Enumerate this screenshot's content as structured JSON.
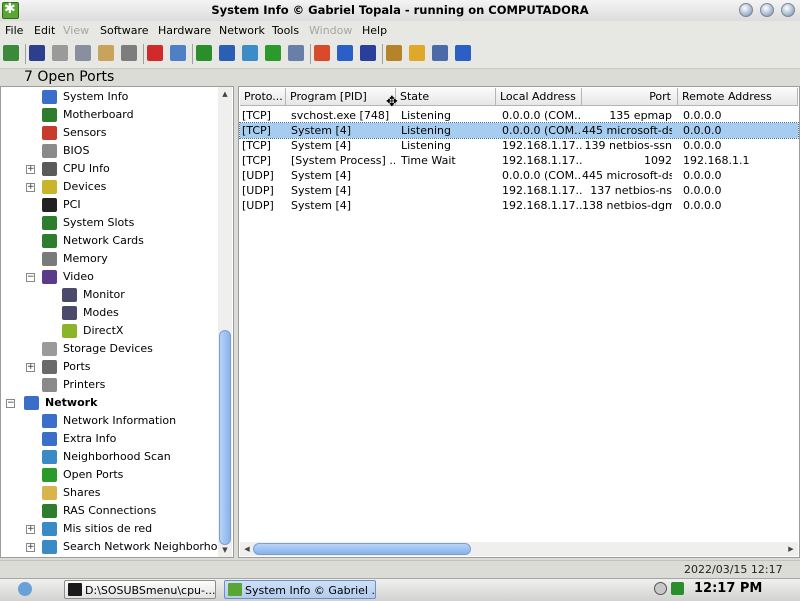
{
  "window": {
    "title": "System Info  © Gabriel Topala - running on COMPUTADORA"
  },
  "menu": [
    {
      "label": "File",
      "enabled": true
    },
    {
      "label": "Edit",
      "enabled": true
    },
    {
      "label": "View",
      "enabled": false
    },
    {
      "label": "Software",
      "enabled": true
    },
    {
      "label": "Hardware",
      "enabled": true
    },
    {
      "label": "Network",
      "enabled": true
    },
    {
      "label": "Tools",
      "enabled": true
    },
    {
      "label": "Window",
      "enabled": false
    },
    {
      "label": "Help",
      "enabled": true
    }
  ],
  "toolbar_icons": [
    {
      "name": "exit-icon",
      "color": "#3a8a3a"
    },
    {
      "name": "save-icon",
      "color": "#2b3f8c"
    },
    {
      "name": "cut-icon",
      "color": "#9a9a9a"
    },
    {
      "name": "copy-icon",
      "color": "#8a8fa0"
    },
    {
      "name": "paste-icon",
      "color": "#c9a35a"
    },
    {
      "name": "print-icon",
      "color": "#7d7d7d"
    },
    {
      "name": "stop-icon",
      "color": "#d12a2a"
    },
    {
      "name": "message-icon",
      "color": "#4f7fc4"
    },
    {
      "name": "color-icon",
      "color": "#2a8f2a"
    },
    {
      "name": "chart-icon",
      "color": "#2a5fb5"
    },
    {
      "name": "globe-icon",
      "color": "#3c8cc8"
    },
    {
      "name": "transfer-icon",
      "color": "#2a9a2a"
    },
    {
      "name": "report-icon",
      "color": "#6a7fa8"
    },
    {
      "name": "power-icon",
      "color": "#d84a2a"
    },
    {
      "name": "refresh-icon",
      "color": "#2a5fc8"
    },
    {
      "name": "shield-icon",
      "color": "#2a3f9a"
    },
    {
      "name": "gallery-icon",
      "color": "#b5832a"
    },
    {
      "name": "weather-icon",
      "color": "#e0a82a"
    },
    {
      "name": "options-icon",
      "color": "#4a6aa8"
    },
    {
      "name": "help-icon",
      "color": "#2a5fc8"
    }
  ],
  "section_title": "7 Open Ports",
  "tree": [
    {
      "label": "System Info",
      "indent": 1,
      "icon": "info-icon",
      "color": "#3a6ec8",
      "expander": ""
    },
    {
      "label": "Motherboard",
      "indent": 1,
      "icon": "motherboard-icon",
      "color": "#2e7d2e",
      "expander": ""
    },
    {
      "label": "Sensors",
      "indent": 1,
      "icon": "thermometer-icon",
      "color": "#c83a2a",
      "expander": ""
    },
    {
      "label": "BIOS",
      "indent": 1,
      "icon": "chip-icon",
      "color": "#8a8a8a",
      "expander": ""
    },
    {
      "label": "CPU Info",
      "indent": 1,
      "icon": "cpu-icon",
      "color": "#5a5a5a",
      "expander": "+"
    },
    {
      "label": "Devices",
      "indent": 1,
      "icon": "devices-icon",
      "color": "#c8b52a",
      "expander": "+"
    },
    {
      "label": "PCI",
      "indent": 1,
      "icon": "pci-icon",
      "color": "#222222",
      "expander": ""
    },
    {
      "label": "System Slots",
      "indent": 1,
      "icon": "slots-icon",
      "color": "#2e7d2e",
      "expander": ""
    },
    {
      "label": "Network Cards",
      "indent": 1,
      "icon": "network-card-icon",
      "color": "#2e7d2e",
      "expander": ""
    },
    {
      "label": "Memory",
      "indent": 1,
      "icon": "memory-icon",
      "color": "#7a7a7a",
      "expander": ""
    },
    {
      "label": "Video",
      "indent": 1,
      "icon": "video-icon",
      "color": "#5a3a8a",
      "expander": "−"
    },
    {
      "label": "Monitor",
      "indent": 2,
      "icon": "monitor-icon",
      "color": "#4a4a6a",
      "expander": ""
    },
    {
      "label": "Modes",
      "indent": 2,
      "icon": "modes-icon",
      "color": "#4a4a6a",
      "expander": ""
    },
    {
      "label": "DirectX",
      "indent": 2,
      "icon": "directx-icon",
      "color": "#8ab52a",
      "expander": ""
    },
    {
      "label": "Storage Devices",
      "indent": 1,
      "icon": "storage-icon",
      "color": "#9a9a9a",
      "expander": ""
    },
    {
      "label": "Ports",
      "indent": 1,
      "icon": "ports-icon",
      "color": "#6a6a6a",
      "expander": "+"
    },
    {
      "label": "Printers",
      "indent": 1,
      "icon": "printer-icon",
      "color": "#8a8a8a",
      "expander": ""
    },
    {
      "label": "Network",
      "indent": 0,
      "icon": "network-icon",
      "color": "#3a6ec8",
      "expander": "−",
      "bold": true
    },
    {
      "label": "Network Information",
      "indent": 1,
      "icon": "info-icon",
      "color": "#3a6ec8",
      "expander": ""
    },
    {
      "label": "Extra Info",
      "indent": 1,
      "icon": "info-icon",
      "color": "#3a6ec8",
      "expander": ""
    },
    {
      "label": "Neighborhood Scan",
      "indent": 1,
      "icon": "scan-icon",
      "color": "#3a8ac8",
      "expander": ""
    },
    {
      "label": "Open Ports",
      "indent": 1,
      "icon": "transfer-icon",
      "color": "#2a9a2a",
      "expander": ""
    },
    {
      "label": "Shares",
      "indent": 1,
      "icon": "folder-icon",
      "color": "#d8b54a",
      "expander": ""
    },
    {
      "label": "RAS Connections",
      "indent": 1,
      "icon": "ras-icon",
      "color": "#2e7d2e",
      "expander": ""
    },
    {
      "label": "Mis sitios de red",
      "indent": 1,
      "icon": "globe-icon",
      "color": "#3a8ac8",
      "expander": "+"
    },
    {
      "label": "Search Network Neighborhood",
      "indent": 1,
      "icon": "globe-icon",
      "color": "#3a8ac8",
      "expander": "+"
    }
  ],
  "table": {
    "columns": [
      "Proto...",
      "Program [PID]",
      "State",
      "Local Address",
      "Port",
      "Remote Address"
    ],
    "rows": [
      {
        "proto": "[TCP]",
        "program": "svchost.exe [748]",
        "state": "Listening",
        "local": "0.0.0.0 (COM...",
        "port": "135 epmap",
        "remote": "0.0.0.0",
        "selected": false
      },
      {
        "proto": "[TCP]",
        "program": "System [4]",
        "state": "Listening",
        "local": "0.0.0.0 (COM...",
        "port": "445 microsoft-ds",
        "remote": "0.0.0.0",
        "selected": true
      },
      {
        "proto": "[TCP]",
        "program": "System [4]",
        "state": "Listening",
        "local": "192.168.1.17...",
        "port": "139 netbios-ssn",
        "remote": "0.0.0.0",
        "selected": false
      },
      {
        "proto": "[TCP]",
        "program": "[System Process] ...",
        "state": "Time Wait",
        "local": "192.168.1.17...",
        "port": "1092",
        "remote": "192.168.1.1",
        "selected": false
      },
      {
        "proto": "[UDP]",
        "program": "System [4]",
        "state": "",
        "local": "0.0.0.0 (COM...",
        "port": "445 microsoft-ds",
        "remote": "0.0.0.0",
        "selected": false
      },
      {
        "proto": "[UDP]",
        "program": "System [4]",
        "state": "",
        "local": "192.168.1.17...",
        "port": "137 netbios-ns",
        "remote": "0.0.0.0",
        "selected": false
      },
      {
        "proto": "[UDP]",
        "program": "System [4]",
        "state": "",
        "local": "192.168.1.17...",
        "port": "138 netbios-dgm",
        "remote": "0.0.0.0",
        "selected": false
      }
    ]
  },
  "status": {
    "datetime": "2022/03/15 12:17"
  },
  "taskbar": {
    "tasks": [
      {
        "label": "D:\\SOSUBSmenu\\cpu-...",
        "active": false,
        "icon": "console-icon",
        "color": "#1a1a1a"
      },
      {
        "label": "System Info  © Gabriel ...",
        "active": true,
        "icon": "sysinfo-icon",
        "color": "#5aa632"
      }
    ],
    "clock": "12:17 PM"
  }
}
